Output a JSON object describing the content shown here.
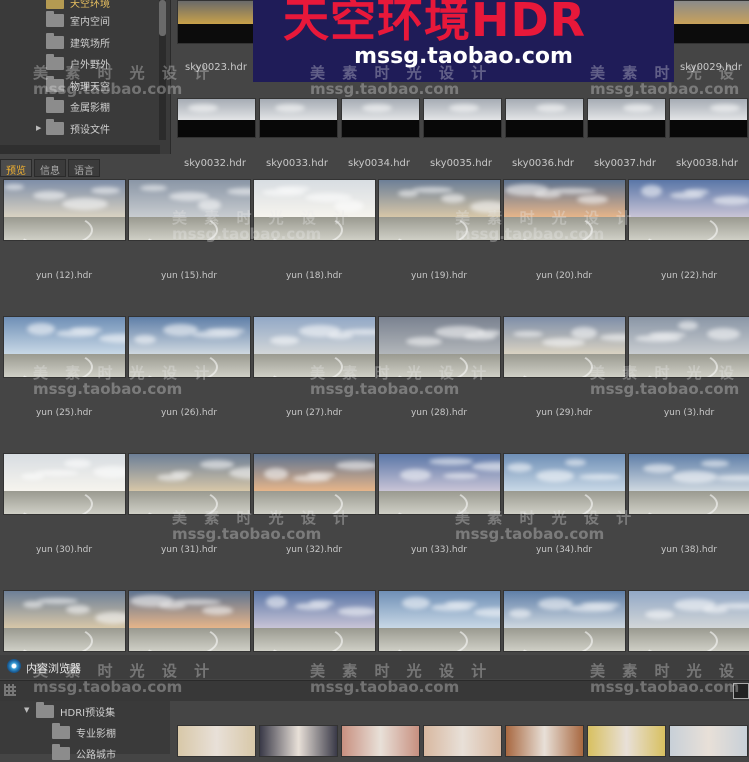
{
  "banner": {
    "title": "天空环境HDR",
    "url": "mssg.taobao.com"
  },
  "watermark": {
    "text": "美 素 时 光 设 计",
    "url": "mssg.taobao.com"
  },
  "tree": {
    "items": [
      {
        "label": "天空环境",
        "selected": true
      },
      {
        "label": "室内空间"
      },
      {
        "label": "建筑场所"
      },
      {
        "label": "户外野外"
      },
      {
        "label": "物理天空"
      },
      {
        "label": "金属影棚"
      },
      {
        "label": "预设文件"
      }
    ]
  },
  "tabs": [
    {
      "label": "预览",
      "active": true
    },
    {
      "label": "信息"
    },
    {
      "label": "语言"
    }
  ],
  "sky_row1": [
    "sky0023.hdr",
    "sky0029.hdr"
  ],
  "sky_row2": [
    "sky0032.hdr",
    "sky0033.hdr",
    "sky0034.hdr",
    "sky0035.hdr",
    "sky0036.hdr",
    "sky0037.hdr",
    "sky0038.hdr"
  ],
  "yun_rows": [
    [
      "yun (12).hdr",
      "yun (15).hdr",
      "yun (18).hdr",
      "yun (19).hdr",
      "yun (20).hdr",
      "yun (22).hdr"
    ],
    [
      "yun (25).hdr",
      "yun (26).hdr",
      "yun (27).hdr",
      "yun (28).hdr",
      "yun (29).hdr",
      "yun (3).hdr"
    ],
    [
      "yun (30).hdr",
      "yun (31).hdr",
      "yun (32).hdr",
      "yun (33).hdr",
      "yun (34).hdr",
      "yun (38).hdr"
    ]
  ],
  "browser": {
    "title": "内容浏览器"
  },
  "bottom_tree": [
    {
      "label": "HDRI预设集"
    },
    {
      "label": "专业影棚"
    },
    {
      "label": "公路城市"
    }
  ],
  "colors": {
    "banner_bg": "#1f1c58",
    "banner_title": "#e8183a",
    "accent": "#f0b030"
  }
}
